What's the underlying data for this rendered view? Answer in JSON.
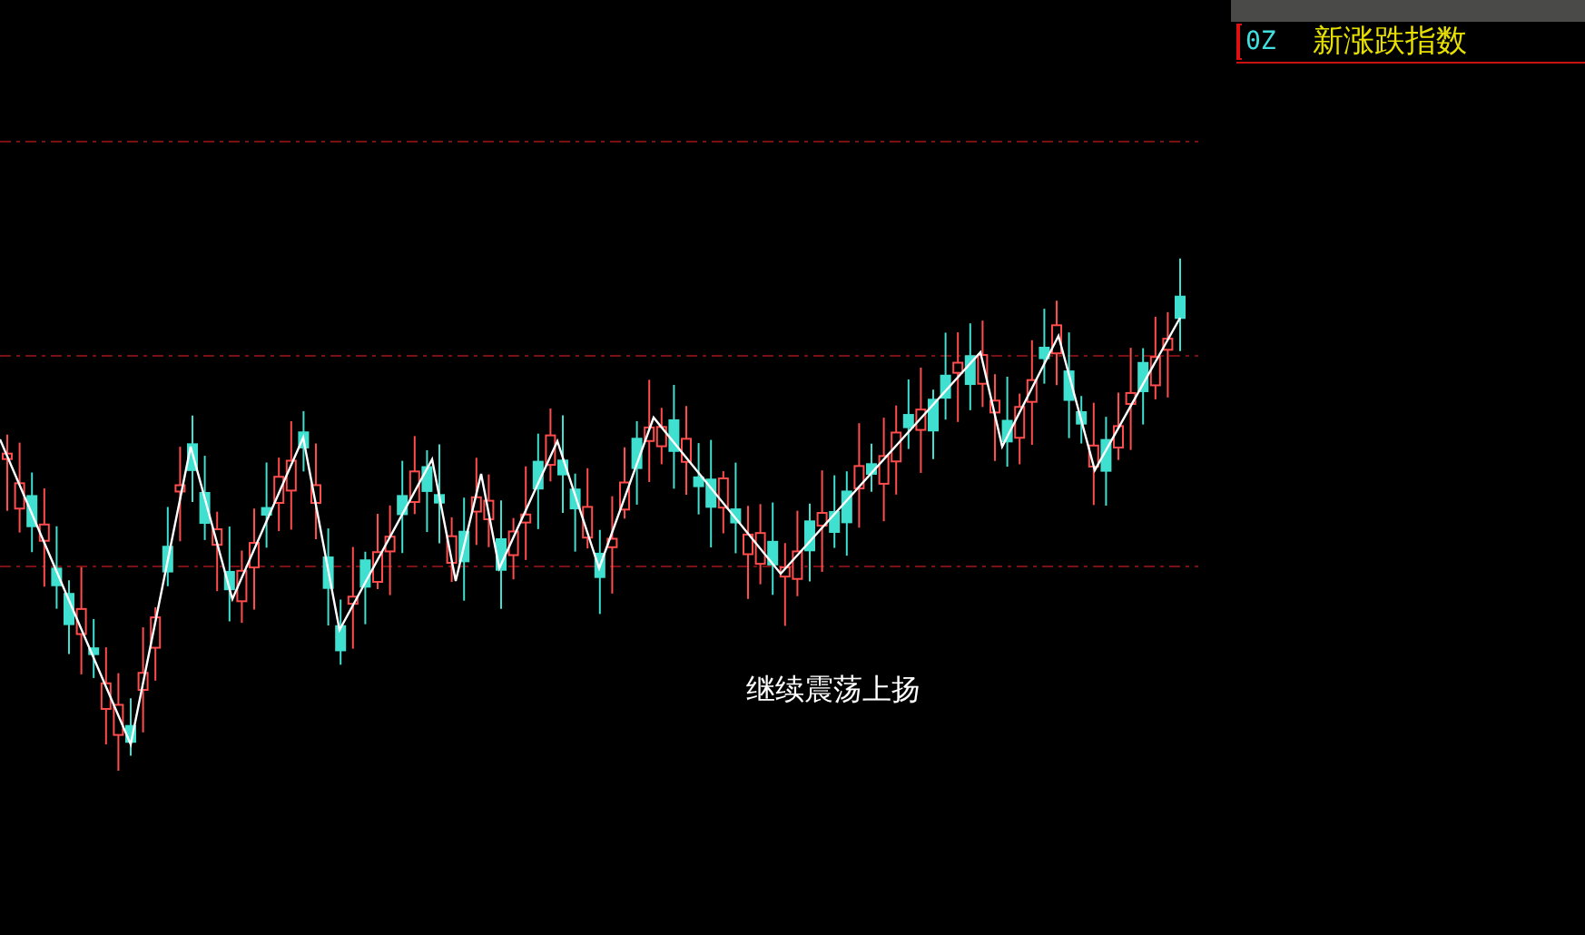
{
  "indicator_panel": {
    "code": "0Z",
    "title": "新涨跌指数"
  },
  "annotation": "继续震荡上扬"
}
